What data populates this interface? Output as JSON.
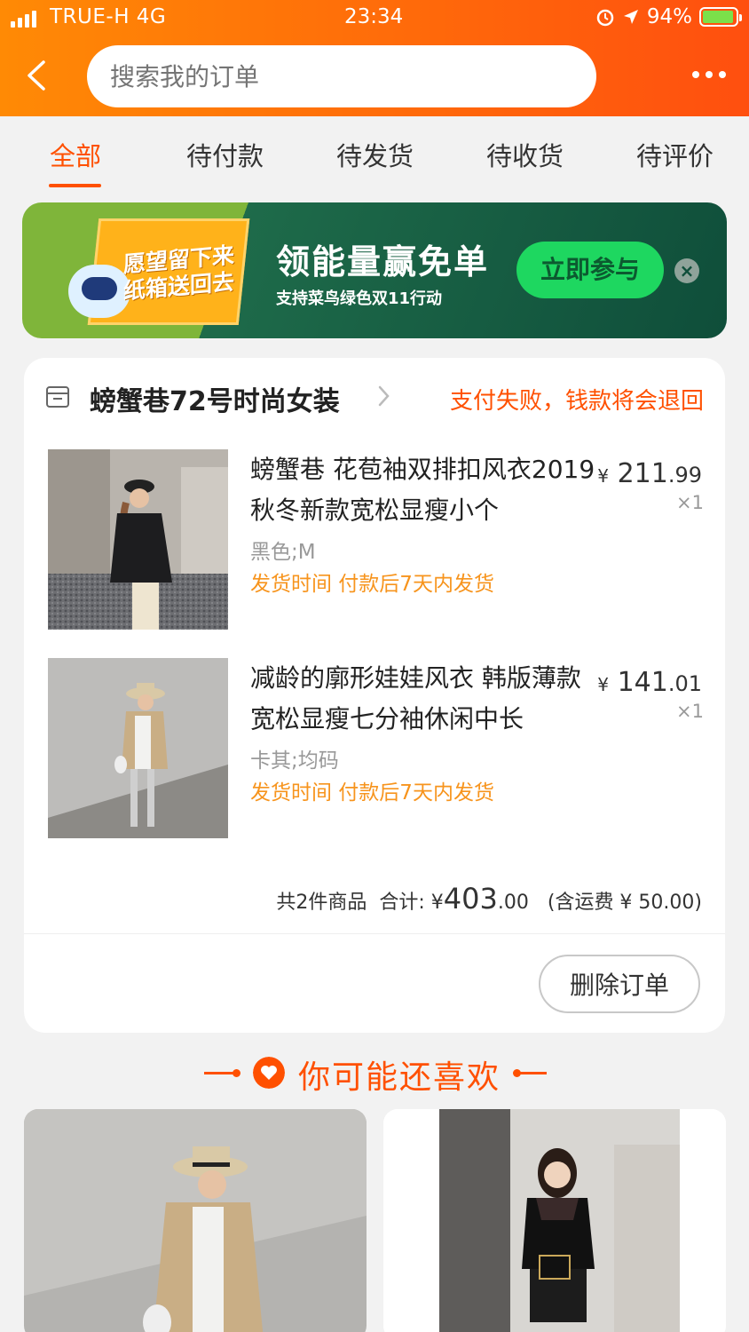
{
  "status_bar": {
    "carrier": "TRUE-H  4G",
    "time": "23:34",
    "battery": "94%",
    "battery_level": 0.94
  },
  "header": {
    "search_placeholder": "搜索我的订单"
  },
  "tabs": [
    {
      "label": "全部",
      "active": true
    },
    {
      "label": "待付款",
      "active": false
    },
    {
      "label": "待发货",
      "active": false
    },
    {
      "label": "待收货",
      "active": false
    },
    {
      "label": "待评价",
      "active": false
    }
  ],
  "banner": {
    "box_text_line1": "愿望留下来",
    "box_text_line2": "纸箱送回去",
    "title": "领能量赢免单",
    "subtitle": "支持菜鸟绿色双11行动",
    "button": "立即参与"
  },
  "order": {
    "shop_name": "螃蟹巷72号时尚女装",
    "status": "支付失败，钱款将会退回",
    "items": [
      {
        "title": "螃蟹巷 花苞袖双排扣风衣2019秋冬新款宽松显瘦小个",
        "sku": "黑色;M",
        "ship": "发货时间  付款后7天内发货",
        "currency": "¥",
        "price_int": "211",
        "price_dec": ".99",
        "qty": "×1"
      },
      {
        "title": "减龄的廓形娃娃风衣 韩版薄款宽松显瘦七分袖休闲中长",
        "sku": "卡其;均码",
        "ship": "发货时间  付款后7天内发货",
        "currency": "¥",
        "price_int": "141",
        "price_dec": ".01",
        "qty": "×1"
      }
    ],
    "summary_count": "共2件商品",
    "summary_label": "合计:",
    "summary_currency": "¥",
    "summary_int": "403",
    "summary_dec": ".00",
    "summary_shipping": "(含运费 ¥ 50.00)",
    "delete_button": "删除订单"
  },
  "recommend": {
    "title": "你可能还喜欢"
  },
  "colors": {
    "accent": "#ff5000",
    "header_start": "#ff8a05",
    "header_end": "#ff4f0f",
    "ship_text": "#f7941d",
    "banner_green": "#0f4e3a"
  }
}
